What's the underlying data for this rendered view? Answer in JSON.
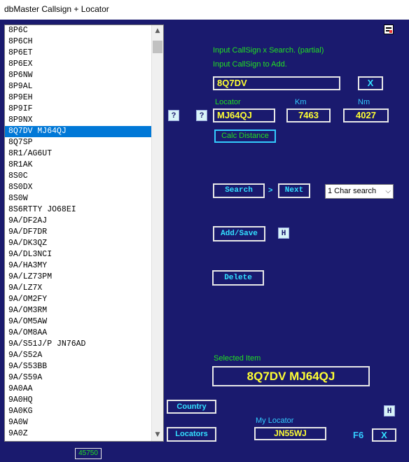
{
  "window": {
    "title": "dbMaster Callsign + Locator"
  },
  "list": {
    "items": [
      "8P6C",
      "8P6CH",
      "8P6ET",
      "8P6EX",
      "8P6NW",
      "8P9AL",
      "8P9EH",
      "8P9IF",
      "8P9NX",
      "8Q7DV MJ64QJ",
      "8Q7SP",
      "8R1/AG6UT",
      "8R1AK",
      "8S0C",
      "8S0DX",
      "8S0W",
      "8S6RTTY JO68EI",
      "9A/DF2AJ",
      "9A/DF7DR",
      "9A/DK3QZ",
      "9A/DL3NCI",
      "9A/HA3MY",
      "9A/LZ73PM",
      "9A/LZ7X",
      "9A/OM2FY",
      "9A/OM3RM",
      "9A/OM5AW",
      "9A/OM8AA",
      "9A/S51J/P JN76AD",
      "9A/S52A",
      "9A/S53BB",
      "9A/S59A",
      "9A0AA",
      "9A0HQ",
      "9A0KG",
      "9A0W",
      "9A0Z"
    ],
    "selected_index": 9
  },
  "labels": {
    "search_hint": "Input CallSign x Search. (partial)",
    "add_hint": "Input CallSign to Add.",
    "locator": "Locator",
    "km": "Km",
    "nm": "Nm",
    "selected_item": "Selected Item",
    "my_locator": "My Locator",
    "f6": "F6"
  },
  "fields": {
    "callsign": "8Q7DV",
    "locator": "MJ64QJ",
    "km": "7463",
    "nm": "4027",
    "my_locator": "JN55WJ",
    "selected_item": "8Q7DV MJ64QJ"
  },
  "buttons": {
    "clear": "X",
    "help_left": "?",
    "help_right": "?",
    "calc_distance": "Calc Distance",
    "search": "Search",
    "next_arrow": ">",
    "next": "Next",
    "add_save": "Add/Save",
    "h_add": "H",
    "delete": "Delete",
    "country": "Country",
    "locators": "Locators",
    "h_bottom": "H",
    "close": "X"
  },
  "search_mode": {
    "selected": "1 Char search"
  },
  "status": {
    "count": "45750"
  },
  "icons": {
    "scroll_up": "▲",
    "scroll_down": "▼",
    "combo_chevron": "⌵"
  }
}
